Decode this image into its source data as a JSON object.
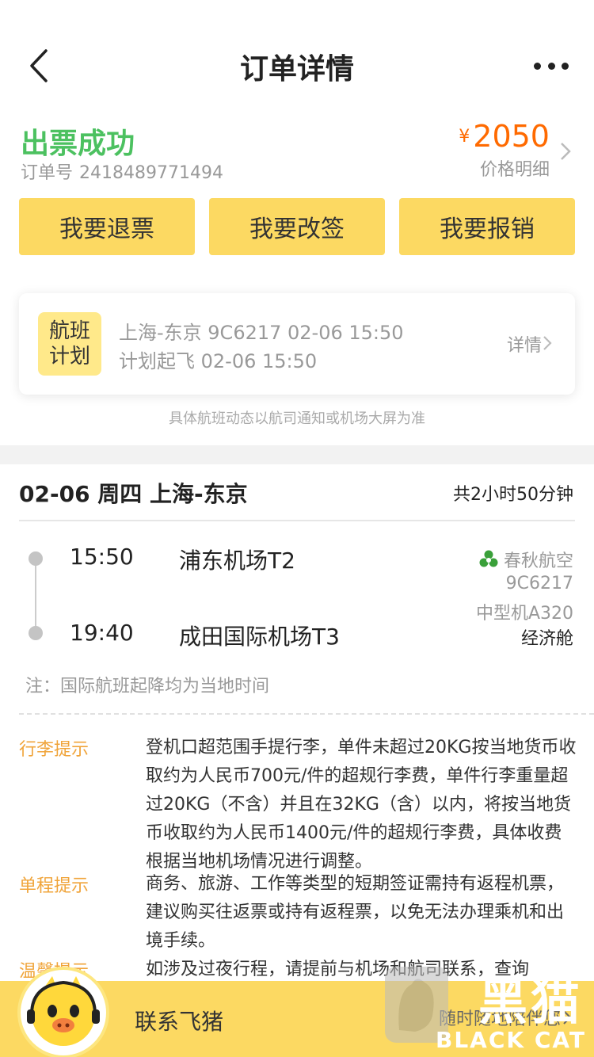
{
  "nav": {
    "title": "订单详情"
  },
  "order": {
    "status": "出票成功",
    "number_label": "订单号",
    "number": "2418489771494",
    "currency": "¥",
    "price": "2050",
    "price_detail": "价格明细"
  },
  "actions": {
    "refund": "我要退票",
    "change": "我要改签",
    "reimburse": "我要报销"
  },
  "flight_plan": {
    "badge_line1": "航班",
    "badge_line2": "计划",
    "line1": "上海-东京 9C6217 02-06 15:50",
    "line2": "计划起飞 02-06 15:50",
    "detail": "详情"
  },
  "notice": "具体航班动态以航司通知或机场大屏为准",
  "itinerary": {
    "header": "02-06 周四 上海-东京",
    "duration": "共2小时50分钟",
    "depart_time": "15:50",
    "depart_airport": "浦东机场T2",
    "arrive_time": "19:40",
    "arrive_airport": "成田国际机场T3",
    "airline": "春秋航空",
    "flight_no": "9C6217",
    "plane": "中型机A320",
    "cabin": "经济舱",
    "local_note": "注：国际航班起降均为当地时间"
  },
  "tips": [
    {
      "label": "行李提示",
      "text": "登机口超范围手提行李，单件未超过20KG按当地货币收取约为人民币700元/件的超规行李费，单件行李重量超过20KG（不含）并且在32KG（含）以内，将按当地货币收取约为人民币1400元/件的超规行李费，具体收费根据当地机场情况进行调整。"
    },
    {
      "label": "单程提示",
      "text": "商务、旅游、工作等类型的短期签证需持有返程机票，建议购买往返票或持有返程票，以免无法办理乘机和出境手续。"
    },
    {
      "label": "温馨提示",
      "text": "如涉及过夜行程，请提前与机场和航司联系，查询"
    }
  ],
  "bottom": {
    "contact": "联系飞猪",
    "anytime": "随时随地陪伴您"
  },
  "watermark": {
    "cn": "黑猫",
    "en": "BLACK CAT"
  },
  "colors": {
    "accent": "#fcd962",
    "success": "#4cc160",
    "price": "#ff6a00",
    "tip_label": "#f0a43a"
  },
  "icons": {
    "back": "chevron-left-icon",
    "more": "more-dots-icon",
    "airline": "spring-airlines-logo-icon"
  }
}
